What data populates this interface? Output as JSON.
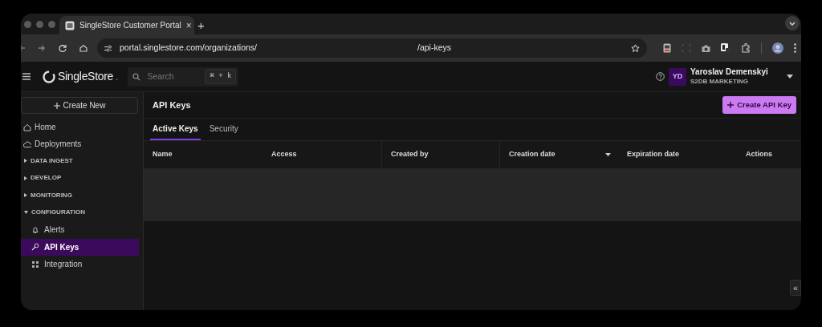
{
  "browser": {
    "tab_title": "SingleStore Customer Portal",
    "tab_close": "×",
    "new_tab": "+",
    "url_start": "portal.singlestore.com/organizations/",
    "url_end": "/api-keys"
  },
  "header": {
    "logo_text": "SingleStore",
    "logo_dot": ".",
    "search_placeholder": "Search",
    "shortcut": "⌘ + k",
    "user": {
      "initials": "YD",
      "name": "Yaroslav Demenskyi",
      "org": "S2DB MARKETING"
    }
  },
  "sidebar": {
    "create_label": "Create New",
    "items": [
      {
        "kind": "link",
        "label": "Home",
        "selected": false
      },
      {
        "kind": "link",
        "label": "Deployments",
        "selected": false
      },
      {
        "kind": "section",
        "label": "DATA INGEST",
        "expanded": false
      },
      {
        "kind": "section",
        "label": "DEVELOP",
        "expanded": false
      },
      {
        "kind": "section",
        "label": "MONITORING",
        "expanded": false
      },
      {
        "kind": "section",
        "label": "CONFIGURATION",
        "expanded": true,
        "children": [
          {
            "label": "Alerts",
            "selected": false
          },
          {
            "label": "API Keys",
            "selected": true
          },
          {
            "label": "Integration",
            "selected": false
          }
        ]
      }
    ]
  },
  "page": {
    "title": "API Keys",
    "create_button": "Create API Key",
    "tabs": [
      {
        "label": "Active Keys",
        "selected": true
      },
      {
        "label": "Security",
        "selected": false
      }
    ]
  },
  "table": {
    "columns": [
      {
        "label": "Name"
      },
      {
        "label": "Access"
      },
      {
        "label": "Created by"
      },
      {
        "label": "Creation date",
        "sorted": true
      },
      {
        "label": "Expiration date"
      },
      {
        "label": "Actions"
      }
    ]
  },
  "collapse_button": "«"
}
